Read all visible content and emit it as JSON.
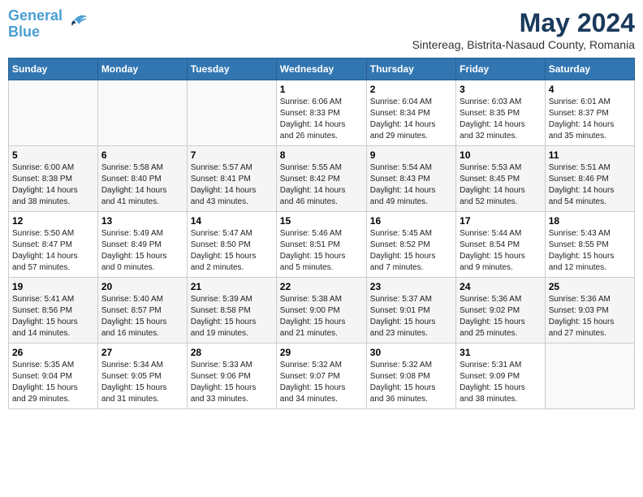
{
  "header": {
    "logo_line1": "General",
    "logo_line2": "Blue",
    "month_title": "May 2024",
    "location": "Sintereag, Bistrita-Nasaud County, Romania"
  },
  "weekdays": [
    "Sunday",
    "Monday",
    "Tuesday",
    "Wednesday",
    "Thursday",
    "Friday",
    "Saturday"
  ],
  "weeks": [
    [
      {
        "day": "",
        "info": ""
      },
      {
        "day": "",
        "info": ""
      },
      {
        "day": "",
        "info": ""
      },
      {
        "day": "1",
        "info": "Sunrise: 6:06 AM\nSunset: 8:33 PM\nDaylight: 14 hours\nand 26 minutes."
      },
      {
        "day": "2",
        "info": "Sunrise: 6:04 AM\nSunset: 8:34 PM\nDaylight: 14 hours\nand 29 minutes."
      },
      {
        "day": "3",
        "info": "Sunrise: 6:03 AM\nSunset: 8:35 PM\nDaylight: 14 hours\nand 32 minutes."
      },
      {
        "day": "4",
        "info": "Sunrise: 6:01 AM\nSunset: 8:37 PM\nDaylight: 14 hours\nand 35 minutes."
      }
    ],
    [
      {
        "day": "5",
        "info": "Sunrise: 6:00 AM\nSunset: 8:38 PM\nDaylight: 14 hours\nand 38 minutes."
      },
      {
        "day": "6",
        "info": "Sunrise: 5:58 AM\nSunset: 8:40 PM\nDaylight: 14 hours\nand 41 minutes."
      },
      {
        "day": "7",
        "info": "Sunrise: 5:57 AM\nSunset: 8:41 PM\nDaylight: 14 hours\nand 43 minutes."
      },
      {
        "day": "8",
        "info": "Sunrise: 5:55 AM\nSunset: 8:42 PM\nDaylight: 14 hours\nand 46 minutes."
      },
      {
        "day": "9",
        "info": "Sunrise: 5:54 AM\nSunset: 8:43 PM\nDaylight: 14 hours\nand 49 minutes."
      },
      {
        "day": "10",
        "info": "Sunrise: 5:53 AM\nSunset: 8:45 PM\nDaylight: 14 hours\nand 52 minutes."
      },
      {
        "day": "11",
        "info": "Sunrise: 5:51 AM\nSunset: 8:46 PM\nDaylight: 14 hours\nand 54 minutes."
      }
    ],
    [
      {
        "day": "12",
        "info": "Sunrise: 5:50 AM\nSunset: 8:47 PM\nDaylight: 14 hours\nand 57 minutes."
      },
      {
        "day": "13",
        "info": "Sunrise: 5:49 AM\nSunset: 8:49 PM\nDaylight: 15 hours\nand 0 minutes."
      },
      {
        "day": "14",
        "info": "Sunrise: 5:47 AM\nSunset: 8:50 PM\nDaylight: 15 hours\nand 2 minutes."
      },
      {
        "day": "15",
        "info": "Sunrise: 5:46 AM\nSunset: 8:51 PM\nDaylight: 15 hours\nand 5 minutes."
      },
      {
        "day": "16",
        "info": "Sunrise: 5:45 AM\nSunset: 8:52 PM\nDaylight: 15 hours\nand 7 minutes."
      },
      {
        "day": "17",
        "info": "Sunrise: 5:44 AM\nSunset: 8:54 PM\nDaylight: 15 hours\nand 9 minutes."
      },
      {
        "day": "18",
        "info": "Sunrise: 5:43 AM\nSunset: 8:55 PM\nDaylight: 15 hours\nand 12 minutes."
      }
    ],
    [
      {
        "day": "19",
        "info": "Sunrise: 5:41 AM\nSunset: 8:56 PM\nDaylight: 15 hours\nand 14 minutes."
      },
      {
        "day": "20",
        "info": "Sunrise: 5:40 AM\nSunset: 8:57 PM\nDaylight: 15 hours\nand 16 minutes."
      },
      {
        "day": "21",
        "info": "Sunrise: 5:39 AM\nSunset: 8:58 PM\nDaylight: 15 hours\nand 19 minutes."
      },
      {
        "day": "22",
        "info": "Sunrise: 5:38 AM\nSunset: 9:00 PM\nDaylight: 15 hours\nand 21 minutes."
      },
      {
        "day": "23",
        "info": "Sunrise: 5:37 AM\nSunset: 9:01 PM\nDaylight: 15 hours\nand 23 minutes."
      },
      {
        "day": "24",
        "info": "Sunrise: 5:36 AM\nSunset: 9:02 PM\nDaylight: 15 hours\nand 25 minutes."
      },
      {
        "day": "25",
        "info": "Sunrise: 5:36 AM\nSunset: 9:03 PM\nDaylight: 15 hours\nand 27 minutes."
      }
    ],
    [
      {
        "day": "26",
        "info": "Sunrise: 5:35 AM\nSunset: 9:04 PM\nDaylight: 15 hours\nand 29 minutes."
      },
      {
        "day": "27",
        "info": "Sunrise: 5:34 AM\nSunset: 9:05 PM\nDaylight: 15 hours\nand 31 minutes."
      },
      {
        "day": "28",
        "info": "Sunrise: 5:33 AM\nSunset: 9:06 PM\nDaylight: 15 hours\nand 33 minutes."
      },
      {
        "day": "29",
        "info": "Sunrise: 5:32 AM\nSunset: 9:07 PM\nDaylight: 15 hours\nand 34 minutes."
      },
      {
        "day": "30",
        "info": "Sunrise: 5:32 AM\nSunset: 9:08 PM\nDaylight: 15 hours\nand 36 minutes."
      },
      {
        "day": "31",
        "info": "Sunrise: 5:31 AM\nSunset: 9:09 PM\nDaylight: 15 hours\nand 38 minutes."
      },
      {
        "day": "",
        "info": ""
      }
    ]
  ]
}
